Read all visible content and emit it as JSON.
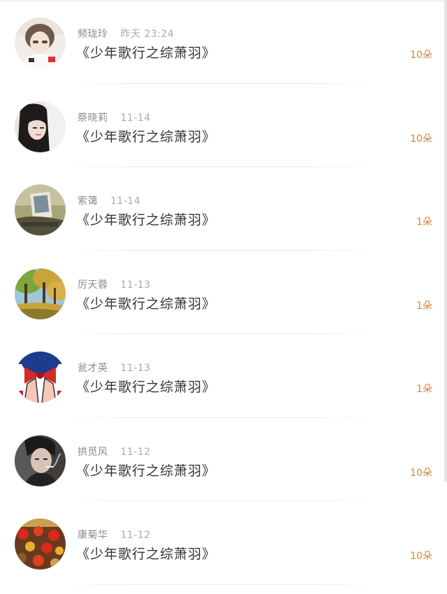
{
  "rows": [
    {
      "name": "频珑玲",
      "time": "昨天 23:24",
      "title": "《少年歌行之综萧羽》",
      "gift": "10朵",
      "avatar": "avatar-girl-photo"
    },
    {
      "name": "祭晓莉",
      "time": "11-14",
      "title": "《少年歌行之综萧羽》",
      "gift": "10朵",
      "avatar": "avatar-girl-portrait"
    },
    {
      "name": "索蔼",
      "time": "11-14",
      "title": "《少年歌行之综萧羽》",
      "gift": "1朵",
      "avatar": "avatar-photo-card"
    },
    {
      "name": "厉天蓉",
      "time": "11-13",
      "title": "《少年歌行之综萧羽》",
      "gift": "1朵",
      "avatar": "avatar-autumn-trees"
    },
    {
      "name": "瓮才英",
      "time": "11-13",
      "title": "《少年歌行之综萧羽》",
      "gift": "1朵",
      "avatar": "avatar-cartoon-bow"
    },
    {
      "name": "拱觅风",
      "time": "11-12",
      "title": "《少年歌行之综萧羽》",
      "gift": "10朵",
      "avatar": "avatar-smoking-man"
    },
    {
      "name": "康菊华",
      "time": "11-12",
      "title": "《少年歌行之综萧羽》",
      "gift": "10朵",
      "avatar": "avatar-lanterns"
    }
  ]
}
